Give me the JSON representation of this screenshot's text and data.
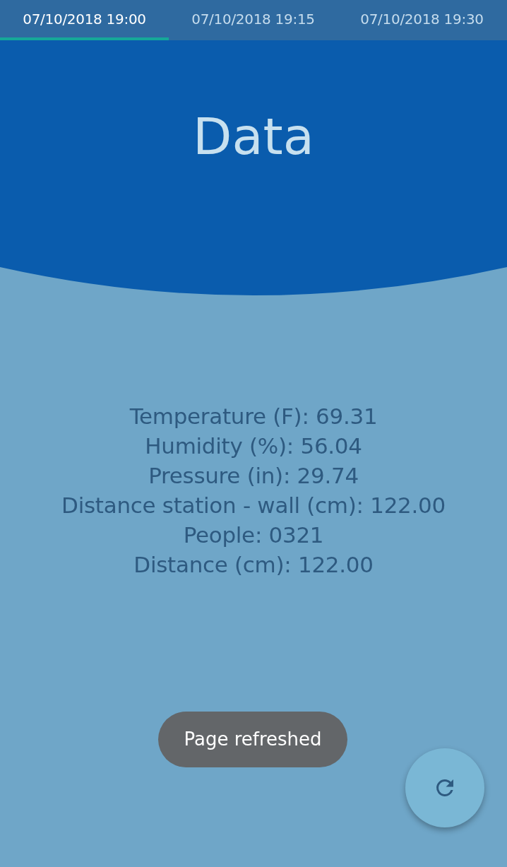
{
  "tabs": [
    {
      "label": "07/10/2018 19:00",
      "selected": true
    },
    {
      "label": "07/10/2018 19:15",
      "selected": false
    },
    {
      "label": "07/10/2018 19:30",
      "selected": false
    }
  ],
  "header": {
    "title": "Data"
  },
  "readings": [
    "Temperature (F): 69.31",
    "Humidity (%): 56.04",
    "Pressure (in): 29.74",
    "Distance station - wall (cm): 122.00",
    "People: 0321",
    "Distance (cm): 122.00"
  ],
  "toast": {
    "text": "Page refreshed"
  }
}
